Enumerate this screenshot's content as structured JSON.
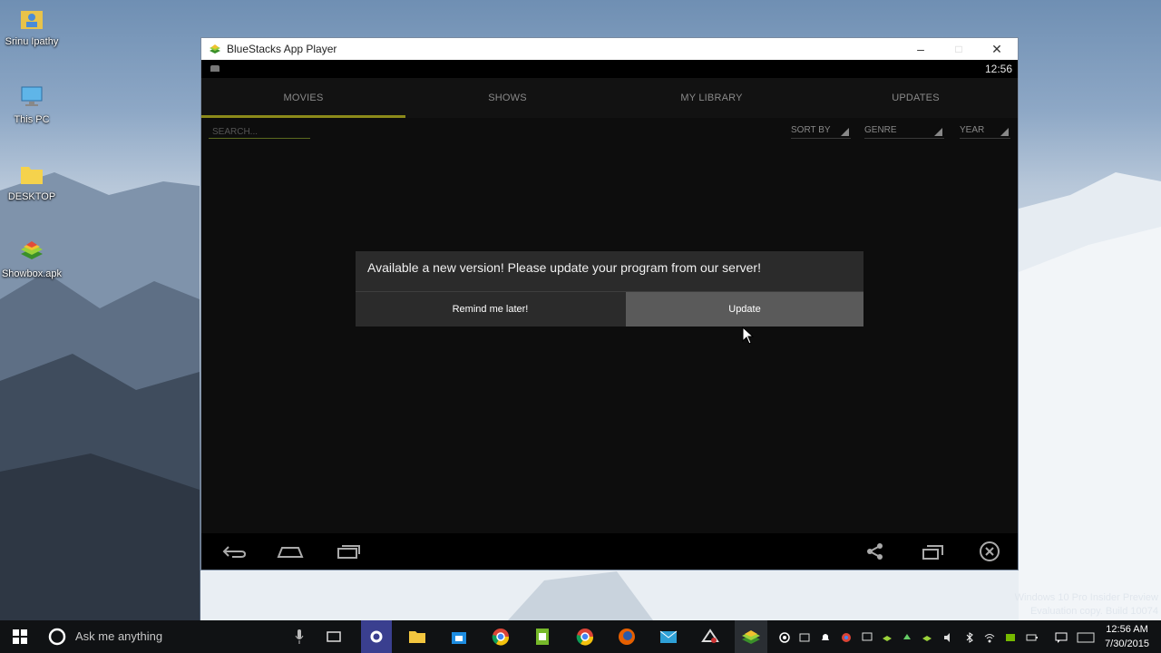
{
  "desktop": {
    "icons": [
      {
        "label": "Srinu Ipathy"
      },
      {
        "label": "This PC"
      },
      {
        "label": "DESKTOP"
      },
      {
        "label": "Showbox.apk"
      }
    ],
    "watermark_line1": "Windows 10 Pro Insider Preview",
    "watermark_line2": "Evaluation copy. Build 10074"
  },
  "window": {
    "title": "BlueStacks App Player",
    "minimize": "–",
    "maximize": "□",
    "close": "✕"
  },
  "android": {
    "clock": "12:56",
    "tabs": [
      {
        "label": "MOVIES",
        "active": true
      },
      {
        "label": "SHOWS"
      },
      {
        "label": "MY LIBRARY"
      },
      {
        "label": "UPDATES"
      }
    ],
    "search_placeholder": "SEARCH...",
    "filters": {
      "sort_by": "SORT BY",
      "genre": "GENRE",
      "year": "YEAR"
    },
    "dialog": {
      "message": "Available a new version! Please update your program from our server!",
      "remind_label": "Remind me later!",
      "update_label": "Update"
    }
  },
  "taskbar": {
    "search_text": "Ask me anything",
    "time": "12:56 AM",
    "date": "7/30/2015"
  },
  "colors": {
    "tab_accent": "#8c8a1a",
    "dialog_bg": "#2b2b2b",
    "update_bg": "#5a5a5a"
  }
}
